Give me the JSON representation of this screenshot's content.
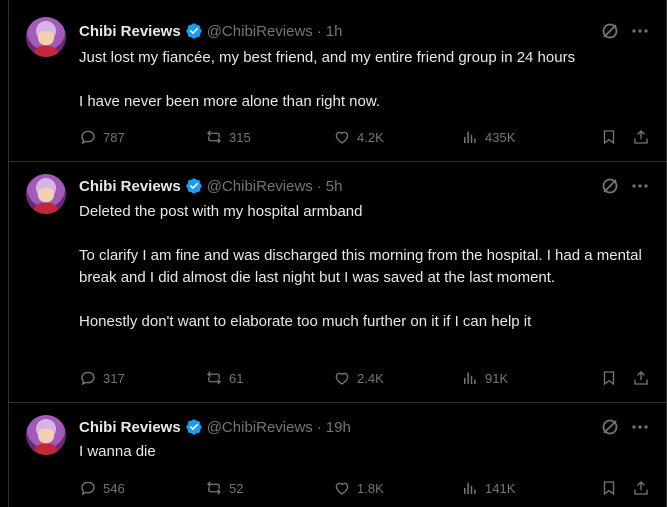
{
  "tweets": [
    {
      "author": "Chibi Reviews",
      "handle": "@ChibiReviews",
      "sep": "·",
      "time": "1h",
      "text": "Just lost my fiancée, my best friend, and my entire friend group in 24 hours\n\nI have never been more alone than right now.",
      "replies": "787",
      "reposts": "315",
      "likes": "4.2K",
      "views": "435K"
    },
    {
      "author": "Chibi Reviews",
      "handle": "@ChibiReviews",
      "sep": "·",
      "time": "5h",
      "text": "Deleted the post with my hospital armband\n\nTo clarify I am fine and was discharged this morning from the hospital. I had a mental break and I did almost die last night but I was saved at the last moment.\n\nHonestly don't want to elaborate too much further on it if I can help it",
      "replies": "317",
      "reposts": "61",
      "likes": "2.4K",
      "views": "91K"
    },
    {
      "author": "Chibi Reviews",
      "handle": "@ChibiReviews",
      "sep": "·",
      "time": "19h",
      "text": "I wanna die",
      "replies": "546",
      "reposts": "52",
      "likes": "1.8K",
      "views": "141K"
    }
  ],
  "icons": {
    "verified": "verified-badge-icon",
    "grok": "grok-icon",
    "more": "more-icon",
    "reply": "reply-icon",
    "repost": "repost-icon",
    "like": "like-icon",
    "views": "views-icon",
    "bookmark": "bookmark-icon",
    "share": "share-icon"
  },
  "colors": {
    "background": "#000000",
    "text": "#e7e9ea",
    "muted": "#71767b",
    "verified": "#1d9bf0",
    "divider": "#2f3336"
  }
}
